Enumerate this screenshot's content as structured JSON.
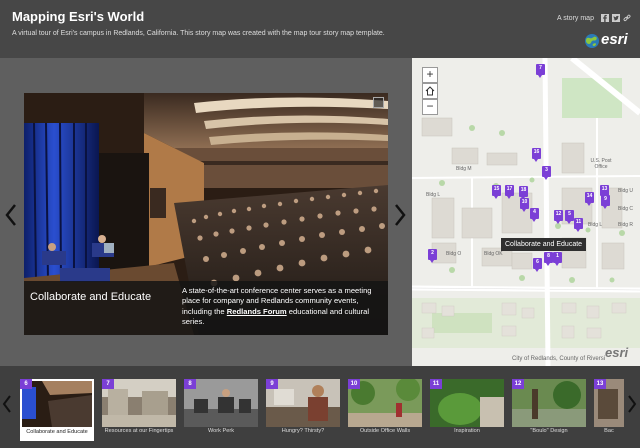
{
  "header": {
    "title": "Mapping Esri's World",
    "subtitle": "A virtual tour of Esri's campus in Redlands, California. This story map was created with the map tour story map template.",
    "story_link": "A story map",
    "logo_text": "esri",
    "share_icons": [
      "facebook-icon",
      "twitter-icon",
      "link-icon"
    ]
  },
  "media": {
    "caption_title": "Collaborate and Educate",
    "caption_text_before": "A state-of-the-art conference center serves as a meeting place for company and Redlands community events, including the ",
    "caption_link": "Redlands Forum",
    "caption_text_after": " educational and cultural series."
  },
  "map": {
    "zoom_in": "+",
    "zoom_out": "−",
    "tooltip": "Collaborate and Educate",
    "attribution": "City of Redlands, County of Riversi",
    "logo_text": "esri",
    "labels": {
      "bldg_m": "Bldg M",
      "bldg_l1": "Bldg L",
      "bldg_o": "Bldg O",
      "bldg_ok": "Bldg OK",
      "us_post": "U.S. Post Office",
      "bldg_u": "Bldg U",
      "bldg_c": "Bldg C",
      "bldg_l2": "Bldg L",
      "bldg_r": "Bldg R"
    },
    "markers": [
      "7",
      "16",
      "3",
      "15",
      "17",
      "18",
      "10",
      "4",
      "12",
      "5",
      "11",
      "14",
      "13",
      "9",
      "6",
      "8",
      "1",
      "2"
    ]
  },
  "carousel": {
    "items": [
      {
        "num": "6",
        "label": "Collaborate and Educate"
      },
      {
        "num": "7",
        "label": "Resources at our Fingertips"
      },
      {
        "num": "8",
        "label": "Work Perk"
      },
      {
        "num": "9",
        "label": "Hungry? Thirsty?"
      },
      {
        "num": "10",
        "label": "Outside Office Walls"
      },
      {
        "num": "11",
        "label": "Inspiration"
      },
      {
        "num": "12",
        "label": "\"Boulo\" Design"
      },
      {
        "num": "13",
        "label": "Bac"
      }
    ]
  },
  "colors": {
    "accent": "#7b3fd6",
    "header_bg": "#474747",
    "panel_bg": "#5f5f5f"
  }
}
